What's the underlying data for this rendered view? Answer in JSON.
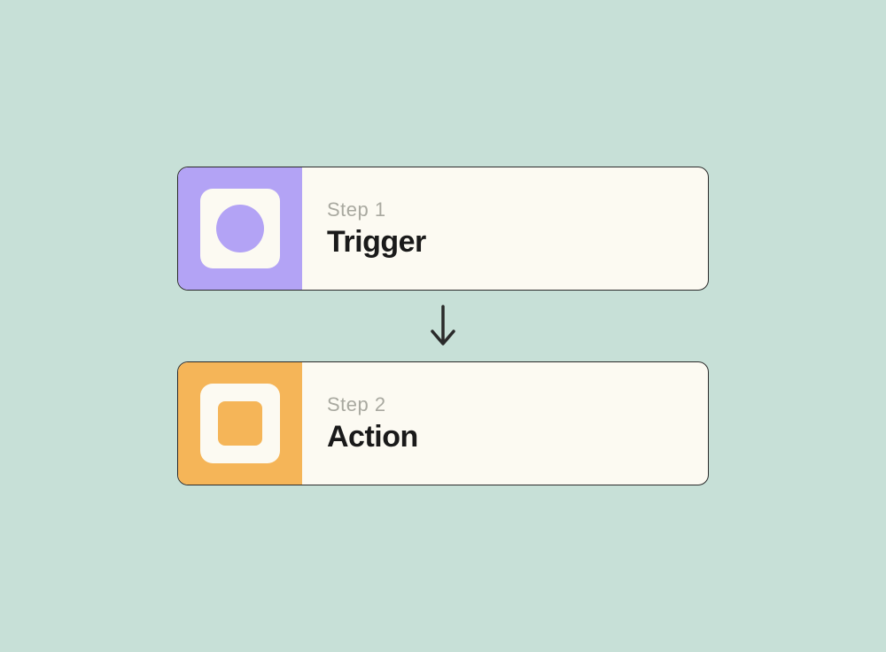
{
  "steps": [
    {
      "label": "Step 1",
      "title": "Trigger",
      "color": "#b3a3f5",
      "icon_shape": "circle"
    },
    {
      "label": "Step 2",
      "title": "Action",
      "color": "#f5b558",
      "icon_shape": "square"
    }
  ],
  "colors": {
    "background": "#c7e0d7",
    "card_background": "#fcfaf2",
    "border": "#2a2a2a",
    "label_text": "#a9a9a0",
    "title_text": "#1a1a1a",
    "purple": "#b3a3f5",
    "orange": "#f5b558"
  }
}
